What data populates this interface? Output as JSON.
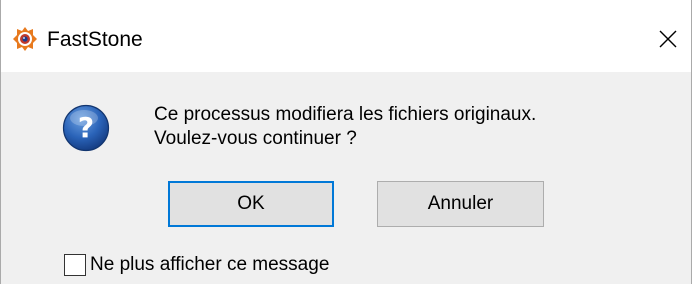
{
  "window": {
    "title": "FastStone",
    "app_icon": "faststone-eye-icon",
    "close_icon": "close-icon"
  },
  "dialog": {
    "icon": "question-icon",
    "message_line1": "Ce processus modifiera les fichiers originaux.",
    "message_line2": "Voulez-vous continuer ?",
    "ok_label": "OK",
    "cancel_label": "Annuler",
    "checkbox_label": "Ne plus afficher ce message",
    "checkbox_checked": false,
    "default_button": "OK"
  },
  "colors": {
    "focus_border": "#0078d7",
    "dialog_bg": "#f0f0f0",
    "titlebar_bg": "#ffffff",
    "button_bg": "#e1e1e1"
  }
}
